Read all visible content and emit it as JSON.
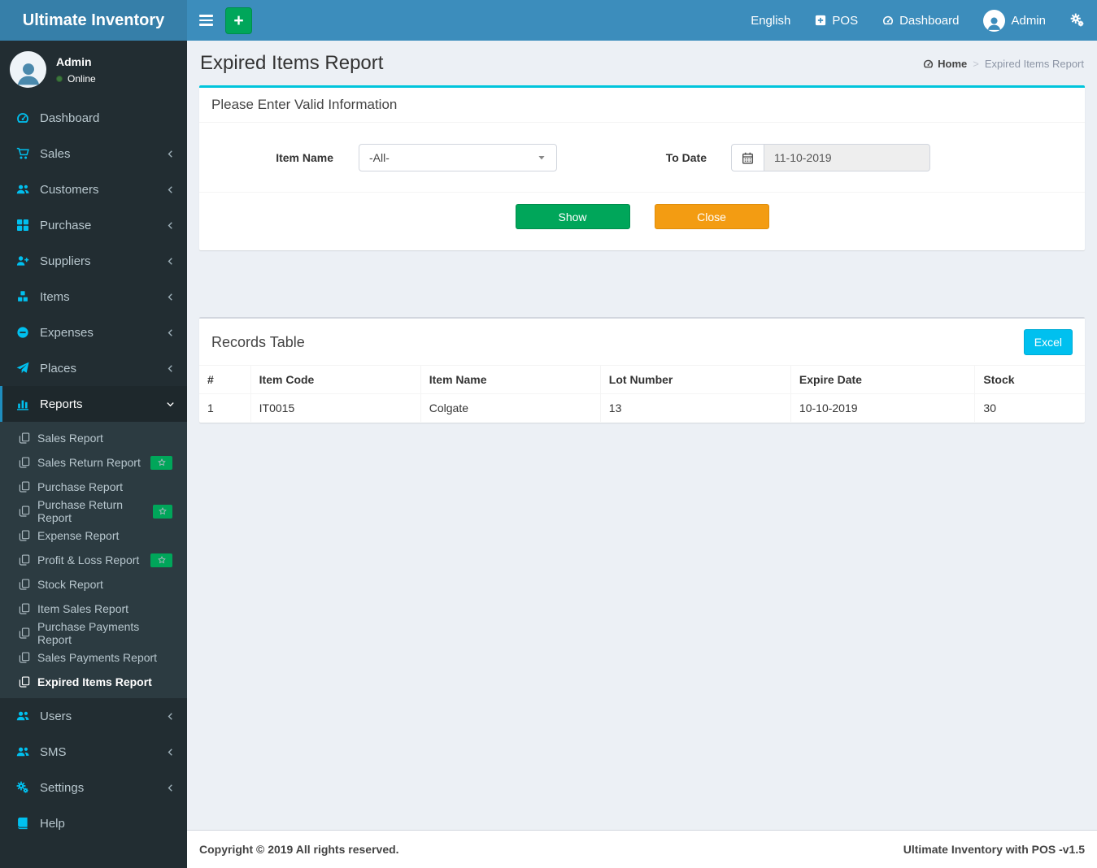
{
  "app": {
    "brand": "Ultimate Inventory"
  },
  "navbar": {
    "language": "English",
    "pos": "POS",
    "dashboard": "Dashboard",
    "username": "Admin"
  },
  "sidebar": {
    "user": {
      "name": "Admin",
      "status": "Online"
    },
    "items": [
      {
        "label": "Dashboard"
      },
      {
        "label": "Sales"
      },
      {
        "label": "Customers"
      },
      {
        "label": "Purchase"
      },
      {
        "label": "Suppliers"
      },
      {
        "label": "Items"
      },
      {
        "label": "Expenses"
      },
      {
        "label": "Places"
      },
      {
        "label": "Reports"
      },
      {
        "label": "Users"
      },
      {
        "label": "SMS"
      },
      {
        "label": "Settings"
      },
      {
        "label": "Help"
      }
    ],
    "reports_submenu": [
      {
        "label": "Sales Report"
      },
      {
        "label": "Sales Return Report",
        "badge": "star"
      },
      {
        "label": "Purchase Report"
      },
      {
        "label": "Purchase Return Report",
        "badge": "star"
      },
      {
        "label": "Expense Report"
      },
      {
        "label": "Profit & Loss Report",
        "badge": "star"
      },
      {
        "label": "Stock Report"
      },
      {
        "label": "Item Sales Report"
      },
      {
        "label": "Purchase Payments Report"
      },
      {
        "label": "Sales Payments Report"
      },
      {
        "label": "Expired Items Report",
        "active": true
      }
    ]
  },
  "page": {
    "title": "Expired Items Report",
    "breadcrumb": {
      "home": "Home",
      "separator": ">",
      "current": "Expired Items Report"
    }
  },
  "filter": {
    "title": "Please Enter Valid Information",
    "item_name_label": "Item Name",
    "item_name_value": "-All-",
    "to_date_label": "To Date",
    "to_date_value": "11-10-2019",
    "show_button": "Show",
    "close_button": "Close"
  },
  "records": {
    "title": "Records Table",
    "excel_button": "Excel",
    "table": {
      "headers": [
        "#",
        "Item Code",
        "Item Name",
        "Lot Number",
        "Expire Date",
        "Stock"
      ],
      "rows": [
        [
          "1",
          "IT0015",
          "Colgate",
          "13",
          "10-10-2019",
          "30"
        ]
      ]
    }
  },
  "footer": {
    "left": "Copyright © 2019 All rights reserved.",
    "right": "Ultimate Inventory with POS -v1.5"
  },
  "colors": {
    "navbar": "#3c8dbc",
    "logo_bg": "#367fa9",
    "sidebar_bg": "#222d32",
    "submenu_bg": "#2c3b41",
    "accent_cyan": "#00c0ef",
    "green": "#00a65a",
    "orange": "#f39c12",
    "content_bg": "#ecf0f5"
  }
}
